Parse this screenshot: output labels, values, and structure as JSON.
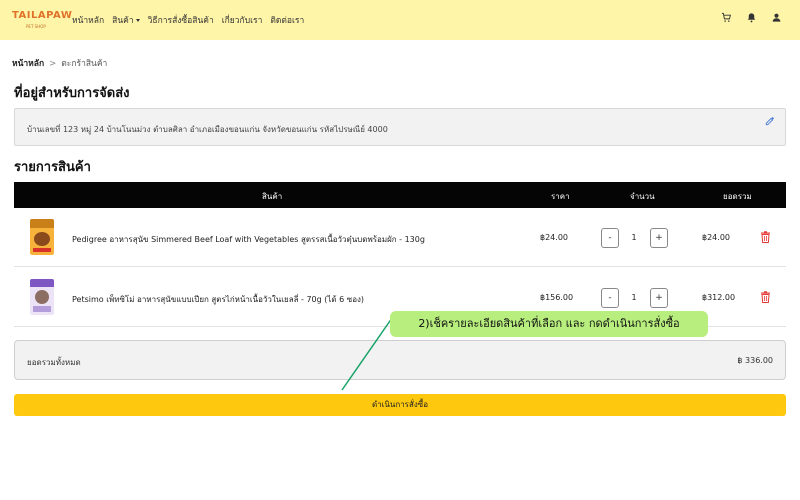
{
  "brand": {
    "logo_text": "TAILAPAW",
    "logo_sub": "PET SHOP"
  },
  "nav": {
    "links": [
      "หน้าหลัก",
      "สินค้า",
      "วิธีการสั่งซื้อสินค้า",
      "เกี่ยวกับเรา",
      "ติดต่อเรา"
    ],
    "icons": [
      "cart-icon",
      "bell-icon",
      "user-icon"
    ]
  },
  "breadcrumb": {
    "home": "หน้าหลัก",
    "separator": ">",
    "current": "ตะกร้าสินค้า"
  },
  "address_section": {
    "title": "ที่อยู่สำหรับการจัดส่ง",
    "text": "บ้านเลขที่ 123 หมู่ 24 บ้านโนนม่วง ตำบลศิลา อำเภอเมืองขอนแก่น จังหวัดขอนแก่น รหัสไปรษณีย์ 4000"
  },
  "items_section": {
    "title": "รายการสินค้า",
    "columns": [
      "สินค้า",
      "ราคา",
      "จำนวน",
      "ยอดรวม"
    ],
    "rows": [
      {
        "name": "Pedigree อาหารสุนัข Simmered Beef Loaf with Vegetables สูตรรสเนื้อวัวตุ๋นบดพร้อมผัก - 130g",
        "price": "฿24.00",
        "qty": "1",
        "minus": "-",
        "plus": "+",
        "subtotal": "฿24.00"
      },
      {
        "name": "Petsimo เพ็ทซิโม่ อาหารสุนัขแบบเปียก สูตรไก่หน้าเนื้อวัวในเยลลี่ - 70g (ได้ 6 ซอง)",
        "price": "฿156.00",
        "qty": "1",
        "minus": "-",
        "plus": "+",
        "subtotal": "฿312.00"
      }
    ]
  },
  "total": {
    "label": "ยอดรวมทั้งหมด",
    "value": "฿ 336.00"
  },
  "checkout_label": "ดำเนินการสั่งซื้อ",
  "annotation": "2)เช็ครายละเอียดสินค้าที่เลือก และ กดดำเนินการสั่งซื้อ",
  "colors": {
    "navbar_bg": "#fff5a8",
    "header_bg": "#050505",
    "checkout_bg": "#fdc80d",
    "delete_red": "#e53935",
    "edit_blue": "#3b6fd6",
    "callout_bg": "#b8ee7e",
    "callout_line": "#1aa36a"
  }
}
